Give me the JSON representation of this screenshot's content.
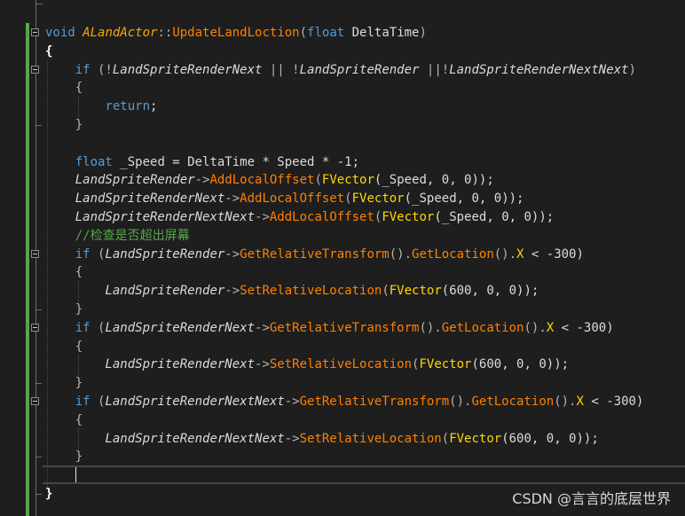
{
  "code": {
    "lines": [
      [
        {
          "t": "void",
          "c": "kw"
        },
        {
          "t": " ",
          "c": "tx"
        },
        {
          "t": "ALandActor",
          "c": "cls"
        },
        {
          "t": "::",
          "c": "op"
        },
        {
          "t": "UpdateLandLoction",
          "c": "fn"
        },
        {
          "t": "(",
          "c": "op"
        },
        {
          "t": "float",
          "c": "kw"
        },
        {
          "t": " DeltaTime",
          "c": "tx"
        },
        {
          "t": ")",
          "c": "op"
        }
      ],
      [
        {
          "t": "{",
          "c": "br"
        }
      ],
      [
        {
          "t": "    ",
          "c": "tx"
        },
        {
          "t": "if",
          "c": "kw"
        },
        {
          "t": " (!",
          "c": "op"
        },
        {
          "t": "LandSpriteRenderNext",
          "c": "var"
        },
        {
          "t": " || !",
          "c": "op"
        },
        {
          "t": "LandSpriteRender",
          "c": "var"
        },
        {
          "t": " ||!",
          "c": "op"
        },
        {
          "t": "LandSpriteRenderNextNext",
          "c": "var"
        },
        {
          "t": ")",
          "c": "op"
        }
      ],
      [
        {
          "t": "    {",
          "c": "op"
        }
      ],
      [
        {
          "t": "        ",
          "c": "tx"
        },
        {
          "t": "return",
          "c": "kw"
        },
        {
          "t": ";",
          "c": "sc"
        }
      ],
      [
        {
          "t": "    }",
          "c": "op"
        }
      ],
      [],
      [
        {
          "t": "    ",
          "c": "tx"
        },
        {
          "t": "float",
          "c": "kw"
        },
        {
          "t": " _Speed = DeltaTime * Speed * -1;",
          "c": "tx"
        }
      ],
      [
        {
          "t": "    ",
          "c": "tx"
        },
        {
          "t": "LandSpriteRender",
          "c": "var"
        },
        {
          "t": "->",
          "c": "op"
        },
        {
          "t": "AddLocalOffset",
          "c": "fn"
        },
        {
          "t": "(",
          "c": "op"
        },
        {
          "t": "FVector",
          "c": "ty"
        },
        {
          "t": "(_Speed, 0, 0));",
          "c": "tx"
        }
      ],
      [
        {
          "t": "    ",
          "c": "tx"
        },
        {
          "t": "LandSpriteRenderNext",
          "c": "var"
        },
        {
          "t": "->",
          "c": "op"
        },
        {
          "t": "AddLocalOffset",
          "c": "fn"
        },
        {
          "t": "(",
          "c": "op"
        },
        {
          "t": "FVector",
          "c": "ty"
        },
        {
          "t": "(_Speed, 0, 0));",
          "c": "tx"
        }
      ],
      [
        {
          "t": "    ",
          "c": "tx"
        },
        {
          "t": "LandSpriteRenderNextNext",
          "c": "var"
        },
        {
          "t": "->",
          "c": "op"
        },
        {
          "t": "AddLocalOffset",
          "c": "fn"
        },
        {
          "t": "(",
          "c": "op"
        },
        {
          "t": "FVector",
          "c": "ty"
        },
        {
          "t": "(_Speed, 0, 0));",
          "c": "tx"
        }
      ],
      [
        {
          "t": "    ",
          "c": "tx"
        },
        {
          "t": "//检查是否超出屏幕",
          "c": "cm"
        }
      ],
      [
        {
          "t": "    ",
          "c": "tx"
        },
        {
          "t": "if",
          "c": "kw"
        },
        {
          "t": " (",
          "c": "op"
        },
        {
          "t": "LandSpriteRender",
          "c": "var"
        },
        {
          "t": "->",
          "c": "op"
        },
        {
          "t": "GetRelativeTransform",
          "c": "fn"
        },
        {
          "t": "().",
          "c": "op"
        },
        {
          "t": "GetLocation",
          "c": "fn"
        },
        {
          "t": "().",
          "c": "op"
        },
        {
          "t": "X",
          "c": "ty"
        },
        {
          "t": " < -300)",
          "c": "tx"
        }
      ],
      [
        {
          "t": "    {",
          "c": "op"
        }
      ],
      [
        {
          "t": "        ",
          "c": "tx"
        },
        {
          "t": "LandSpriteRender",
          "c": "var"
        },
        {
          "t": "->",
          "c": "op"
        },
        {
          "t": "SetRelativeLocation",
          "c": "fn"
        },
        {
          "t": "(",
          "c": "op"
        },
        {
          "t": "FVector",
          "c": "ty"
        },
        {
          "t": "(600, 0, 0));",
          "c": "tx"
        }
      ],
      [
        {
          "t": "    }",
          "c": "op"
        }
      ],
      [
        {
          "t": "    ",
          "c": "tx"
        },
        {
          "t": "if",
          "c": "kw"
        },
        {
          "t": " (",
          "c": "op"
        },
        {
          "t": "LandSpriteRenderNext",
          "c": "var"
        },
        {
          "t": "->",
          "c": "op"
        },
        {
          "t": "GetRelativeTransform",
          "c": "fn"
        },
        {
          "t": "().",
          "c": "op"
        },
        {
          "t": "GetLocation",
          "c": "fn"
        },
        {
          "t": "().",
          "c": "op"
        },
        {
          "t": "X",
          "c": "ty"
        },
        {
          "t": " < -300)",
          "c": "tx"
        }
      ],
      [
        {
          "t": "    {",
          "c": "op"
        }
      ],
      [
        {
          "t": "        ",
          "c": "tx"
        },
        {
          "t": "LandSpriteRenderNext",
          "c": "var"
        },
        {
          "t": "->",
          "c": "op"
        },
        {
          "t": "SetRelativeLocation",
          "c": "fn"
        },
        {
          "t": "(",
          "c": "op"
        },
        {
          "t": "FVector",
          "c": "ty"
        },
        {
          "t": "(600, 0, 0));",
          "c": "tx"
        }
      ],
      [
        {
          "t": "    }",
          "c": "op"
        }
      ],
      [
        {
          "t": "    ",
          "c": "tx"
        },
        {
          "t": "if",
          "c": "kw"
        },
        {
          "t": " (",
          "c": "op"
        },
        {
          "t": "LandSpriteRenderNextNext",
          "c": "var"
        },
        {
          "t": "->",
          "c": "op"
        },
        {
          "t": "GetRelativeTransform",
          "c": "fn"
        },
        {
          "t": "().",
          "c": "op"
        },
        {
          "t": "GetLocation",
          "c": "fn"
        },
        {
          "t": "().",
          "c": "op"
        },
        {
          "t": "X",
          "c": "ty"
        },
        {
          "t": " < -300)",
          "c": "tx"
        }
      ],
      [
        {
          "t": "    {",
          "c": "op"
        }
      ],
      [
        {
          "t": "        ",
          "c": "tx"
        },
        {
          "t": "LandSpriteRenderNextNext",
          "c": "var"
        },
        {
          "t": "->",
          "c": "op"
        },
        {
          "t": "SetRelativeLocation",
          "c": "fn"
        },
        {
          "t": "(",
          "c": "op"
        },
        {
          "t": "FVector",
          "c": "ty"
        },
        {
          "t": "(600, 0, 0));",
          "c": "tx"
        }
      ],
      [
        {
          "t": "    }",
          "c": "op"
        }
      ],
      [],
      [
        {
          "t": "}",
          "c": "br"
        }
      ]
    ]
  },
  "colors": {
    "background": "#1e1e1e",
    "keyword": "#569cd6",
    "function": "#ff8000",
    "type": "#ffd700",
    "member": "#dadada",
    "comment": "#57a64a",
    "change_bar": "#57a64a"
  },
  "watermark": {
    "text": "CSDN @言言的底层世界"
  }
}
